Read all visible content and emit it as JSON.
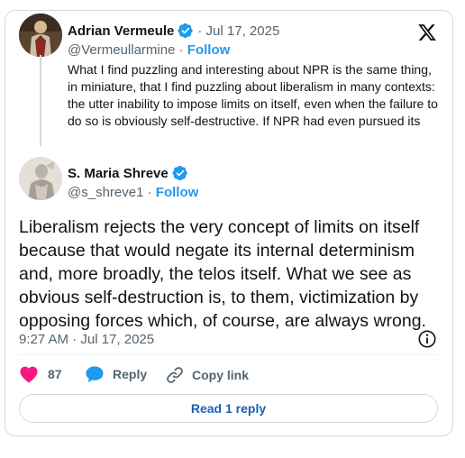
{
  "quoted": {
    "author_name": "Adrian Vermeule",
    "date": "· Jul 17, 2025",
    "handle": "@Vermeullarmine",
    "separator": "·",
    "follow_label": "Follow",
    "text": "What I find puzzling and interesting about NPR is the same thing, in miniature, that I find puzzling about liberalism in many contexts: the utter inability to impose limits on itself, even when the failure to do so is obviously self-destructive. If NPR had even pursued its"
  },
  "post": {
    "author_name": "S. Maria Shreve",
    "handle": "@s_shreve1",
    "separator": "·",
    "follow_label": "Follow",
    "text": "Liberalism rejects the very concept of limits on itself because that would negate its internal determinism and, more broadly, the telos itself. What we see as obvious self-destruction is, to them, victimization by opposing forces which, of course, are always wrong.",
    "timestamp": "9:27 AM · Jul 17, 2025"
  },
  "actions": {
    "like_count": "87",
    "reply_label": "Reply",
    "copy_link_label": "Copy link"
  },
  "read_replies_label": "Read 1 reply",
  "colors": {
    "accent": "#1d9bf0",
    "like": "#f91880",
    "reply_link": "#1d5fb0"
  },
  "icons": [
    "x-logo-icon",
    "verified-badge-icon",
    "info-icon",
    "heart-icon",
    "reply-bubble-icon",
    "link-icon"
  ]
}
